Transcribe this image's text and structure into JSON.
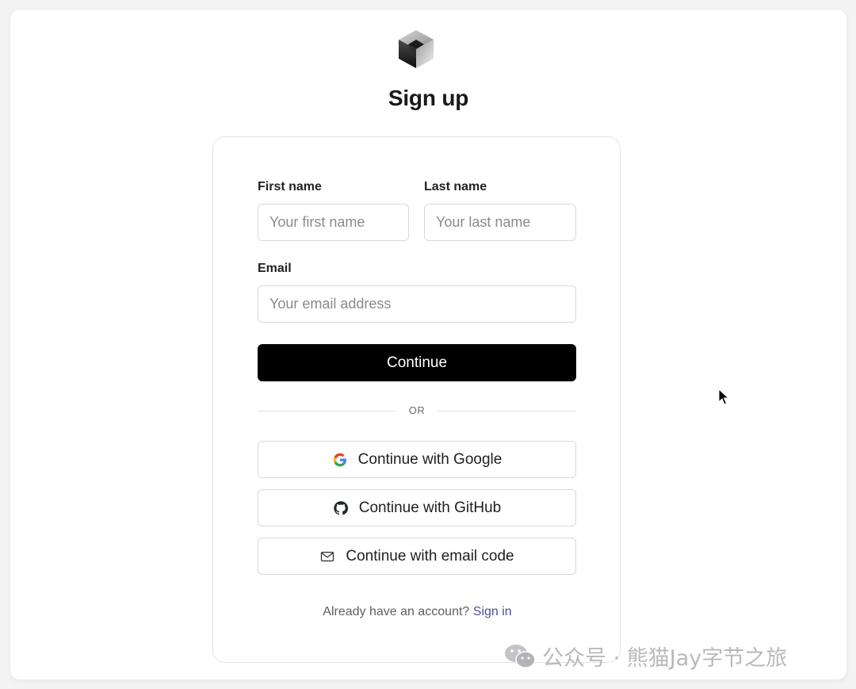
{
  "header": {
    "title": "Sign up",
    "logo_icon": "cube-logo-icon"
  },
  "form": {
    "first_name": {
      "label": "First name",
      "placeholder": "Your first name",
      "value": ""
    },
    "last_name": {
      "label": "Last name",
      "placeholder": "Your last name",
      "value": ""
    },
    "email": {
      "label": "Email",
      "placeholder": "Your email address",
      "value": ""
    },
    "continue_label": "Continue",
    "divider_label": "OR"
  },
  "social": {
    "google": {
      "label": "Continue with Google",
      "icon": "google-icon"
    },
    "github": {
      "label": "Continue with GitHub",
      "icon": "github-icon"
    },
    "email_code": {
      "label": "Continue with email code",
      "icon": "mail-icon"
    }
  },
  "footer": {
    "prompt": "Already have an account?",
    "link": "Sign in"
  },
  "watermark": {
    "text": "公众号 · 熊猫Jay字节之旅",
    "icon": "wechat-icon"
  },
  "colors": {
    "primary_button": "#000000",
    "link": "#4f4f9a",
    "border": "#d9d9dd"
  }
}
